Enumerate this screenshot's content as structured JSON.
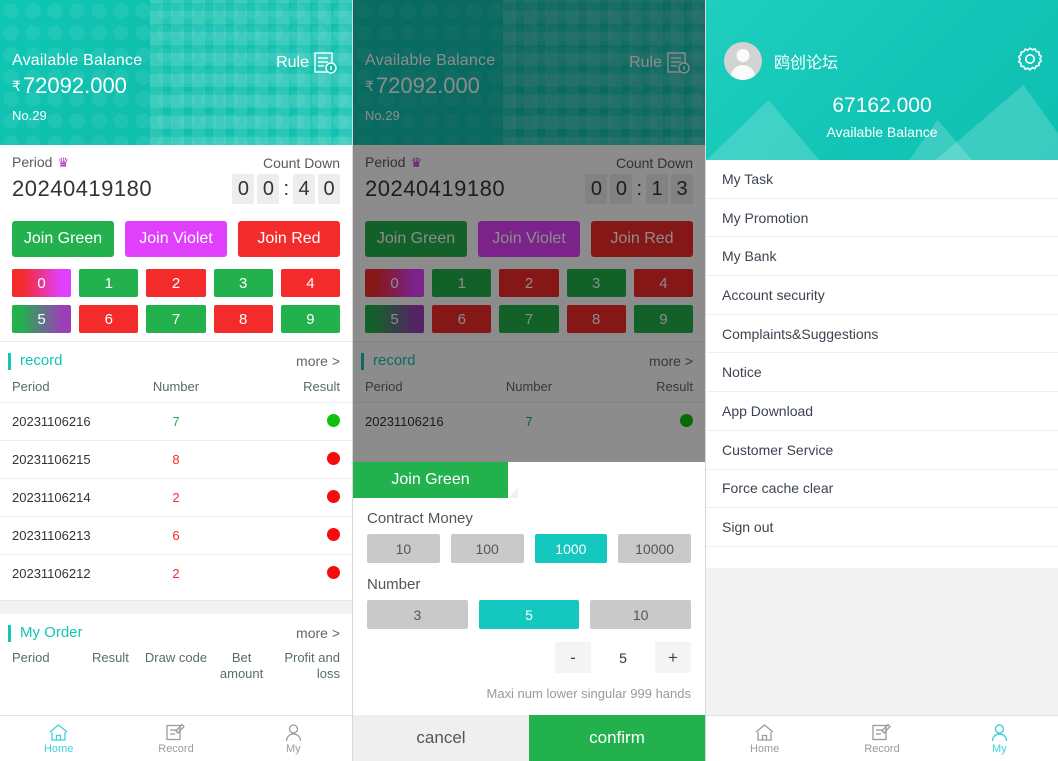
{
  "game": {
    "header": {
      "balance_label": "Available Balance",
      "currency": "₹",
      "balance": "72092.000",
      "period_no": "No.29",
      "rule_label": "Rule"
    },
    "period": {
      "label": "Period",
      "countdown_label": "Count Down",
      "number": "20240419180",
      "countdown_left": [
        "0",
        "0"
      ],
      "countdown_right": [
        "4",
        "0"
      ],
      "countdown_right_mid": [
        "1",
        "3"
      ],
      "separator": ":"
    },
    "joins": [
      {
        "label": "Join Green",
        "color": "#22b14c"
      },
      {
        "label": "Join Violet",
        "color": "#e040fb"
      },
      {
        "label": "Join Red",
        "color": "#f42b2b"
      }
    ],
    "numbers_row1": [
      {
        "label": "0",
        "style": "red-violet"
      },
      {
        "label": "1",
        "style": "green"
      },
      {
        "label": "2",
        "style": "red"
      },
      {
        "label": "3",
        "style": "green"
      },
      {
        "label": "4",
        "style": "red"
      }
    ],
    "numbers_row2": [
      {
        "label": "5",
        "style": "green-violet"
      },
      {
        "label": "6",
        "style": "red"
      },
      {
        "label": "7",
        "style": "green"
      },
      {
        "label": "8",
        "style": "red"
      },
      {
        "label": "9",
        "style": "green"
      }
    ],
    "record": {
      "title": "record",
      "more": "more >",
      "columns": [
        "Period",
        "Number",
        "Result"
      ],
      "rows": [
        {
          "period": "20231106216",
          "number": "7",
          "result": "green"
        },
        {
          "period": "20231106215",
          "number": "8",
          "result": "red"
        },
        {
          "period": "20231106214",
          "number": "2",
          "result": "red"
        },
        {
          "period": "20231106213",
          "number": "6",
          "result": "red"
        },
        {
          "period": "20231106212",
          "number": "2",
          "result": "red"
        }
      ]
    },
    "my_order": {
      "title": "My Order",
      "more": "more >",
      "columns": [
        "Period",
        "Result",
        "Draw code",
        "Bet amount",
        "Profit and loss"
      ]
    },
    "nav": [
      {
        "label": "Home",
        "icon": "home-icon",
        "active": true
      },
      {
        "label": "Record",
        "icon": "record-icon",
        "active": false
      },
      {
        "label": "My",
        "icon": "user-icon",
        "active": false
      }
    ]
  },
  "modal": {
    "tab_label": "Join Green",
    "contract_money_label": "Contract Money",
    "money_options": [
      "10",
      "100",
      "1000",
      "10000"
    ],
    "money_selected": "1000",
    "number_label": "Number",
    "number_options": [
      "3",
      "5",
      "10"
    ],
    "number_selected": "5",
    "stepper": {
      "minus": "-",
      "value": "5",
      "plus": "+"
    },
    "hint": "Maxi num lower singular 999 hands",
    "cancel_label": "cancel",
    "confirm_label": "confirm"
  },
  "profile": {
    "username": "鸥创论坛",
    "balance": "67162.000",
    "balance_label": "Available Balance",
    "menu": [
      "My Task",
      "My Promotion",
      "My Bank",
      "Account security",
      "Complaints&Suggestions",
      "Notice",
      "App Download",
      "Customer Service",
      "Force cache clear",
      "Sign out"
    ],
    "nav": [
      {
        "label": "Home",
        "icon": "home-icon",
        "active": false
      },
      {
        "label": "Record",
        "icon": "record-icon",
        "active": false
      },
      {
        "label": "My",
        "icon": "user-icon",
        "active": true
      }
    ]
  },
  "colors": {
    "teal": "#11bfae",
    "accent": "#14c4b4",
    "green": "#22b14c",
    "red": "#f42b2b",
    "violet": "#e040fb"
  }
}
